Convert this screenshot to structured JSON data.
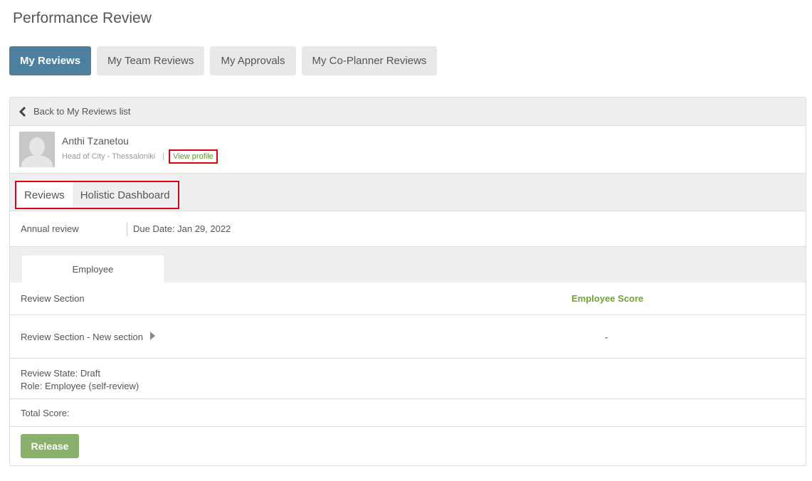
{
  "page": {
    "title": "Performance Review"
  },
  "top_tabs": [
    {
      "label": "My Reviews",
      "active": true
    },
    {
      "label": "My Team Reviews",
      "active": false
    },
    {
      "label": "My Approvals",
      "active": false
    },
    {
      "label": "My Co-Planner Reviews",
      "active": false
    }
  ],
  "back": {
    "label": "Back to My Reviews list"
  },
  "profile": {
    "name": "Anthi Tzanetou",
    "subtitle": "Head of City - Thessaloniki",
    "separator": "|",
    "view_profile": "View profile"
  },
  "inner_tabs": [
    {
      "label": "Reviews",
      "active": true
    },
    {
      "label": "Holistic Dashboard",
      "active": false
    }
  ],
  "review": {
    "type": "Annual review",
    "due_date": "Due Date: Jan 29, 2022"
  },
  "role_tab": {
    "label": "Employee"
  },
  "table": {
    "header_section": "Review Section",
    "header_score": "Employee Score",
    "rows": [
      {
        "section": "Review Section - New section",
        "score": "-"
      }
    ]
  },
  "state": {
    "review_state": "Review State: Draft",
    "role": "Role: Employee (self-review)"
  },
  "total": {
    "label": "Total Score:"
  },
  "actions": {
    "release_label": "Release"
  },
  "colors": {
    "accent": "#4d7f9e",
    "score_green": "#6fa32e",
    "release_green": "#8ab06e",
    "highlight_red": "#e0000f"
  }
}
